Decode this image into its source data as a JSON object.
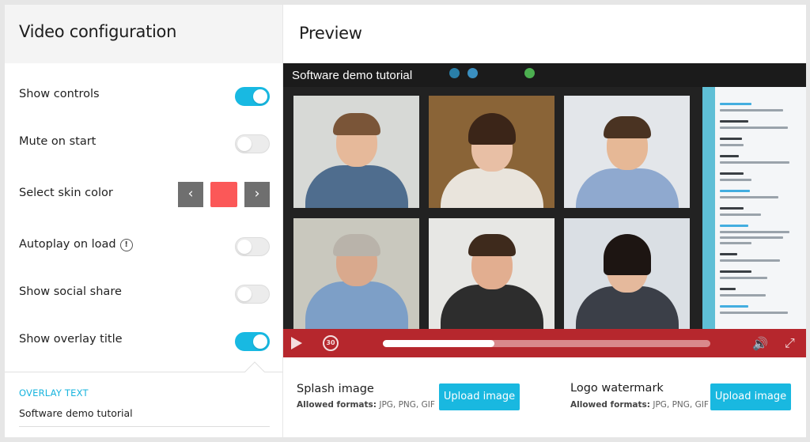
{
  "config": {
    "title": "Video configuration",
    "settings": [
      {
        "label": "Show controls",
        "on": true
      },
      {
        "label": "Mute on start",
        "on": false
      },
      {
        "label": "Select skin color"
      },
      {
        "label": "Autoplay on load",
        "on": false
      },
      {
        "label": "Show social share",
        "on": false
      },
      {
        "label": "Show overlay title",
        "on": true
      }
    ],
    "skin": {
      "prev_icon": "chevron-left-icon",
      "next_icon": "chevron-right-icon",
      "prev_glyph": "‹",
      "next_glyph": "›",
      "color": "#fb5858"
    },
    "autoplay_info_glyph": "!",
    "overlay_text": {
      "label": "OVERLAY TEXT",
      "value": "Software demo tutorial"
    }
  },
  "preview": {
    "title": "Preview",
    "video": {
      "overlay_title": "Software demo tutorial",
      "progress": 0.34,
      "rewind_label": "30",
      "play_icon": "play-icon",
      "volume_glyph": "🔊",
      "fullscreen_glyph": "⤢"
    },
    "splash": {
      "title": "Splash image",
      "formats_label": "Allowed formats:",
      "formats": "JPG, PNG, GIF",
      "button": "Upload image"
    },
    "logo": {
      "title": "Logo watermark",
      "formats_label": "Allowed formats:",
      "formats": "JPG, PNG, GIF",
      "button": "Upload image"
    }
  },
  "colors": {
    "accent": "#18b9e2",
    "controls_bar": "#b6272d",
    "skin": "#fb5858"
  }
}
